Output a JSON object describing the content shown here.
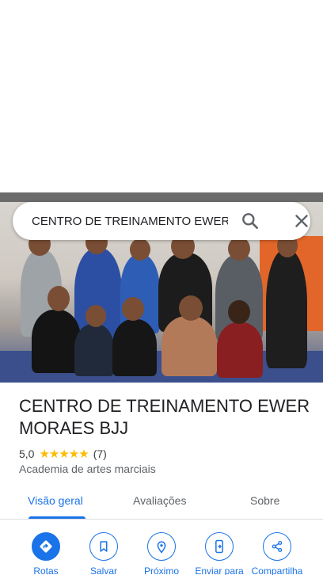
{
  "search": {
    "value": "CENTRO DE TREINAMENTO EWER M"
  },
  "place": {
    "name": "CENTRO DE TREINAMENTO EWER MORAES BJJ",
    "rating": "5,0",
    "stars": "★★★★★",
    "review_count": "(7)",
    "category": "Academia de artes marciais"
  },
  "tabs": [
    {
      "label": "Visão geral",
      "active": true
    },
    {
      "label": "Avaliações",
      "active": false
    },
    {
      "label": "Sobre",
      "active": false
    }
  ],
  "actions": [
    {
      "label": "Rotas",
      "icon": "directions-icon"
    },
    {
      "label": "Salvar",
      "icon": "bookmark-icon"
    },
    {
      "label": "Próximo",
      "icon": "nearby-icon"
    },
    {
      "label": "Enviar para",
      "icon": "send-to-phone-icon"
    },
    {
      "label": "Compartilha",
      "icon": "share-icon"
    }
  ],
  "colors": {
    "accent": "#1a73e8",
    "star": "#fbbc04"
  }
}
